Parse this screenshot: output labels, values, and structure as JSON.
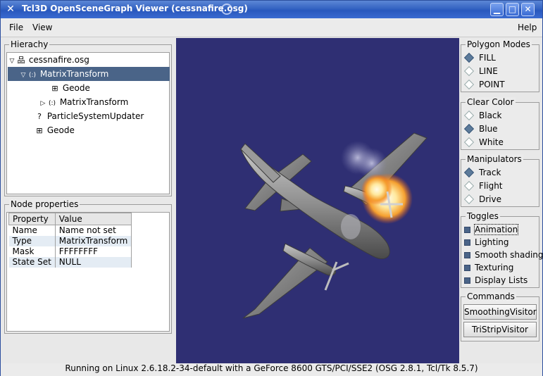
{
  "window": {
    "title": "Tcl3D OpenSceneGraph Viewer (cessnafire.osg)",
    "buttons": {
      "minimize": "▁",
      "maximize": "□",
      "close": "✕"
    }
  },
  "menubar": {
    "file": "File",
    "view": "View",
    "help": "Help"
  },
  "hierarchy": {
    "title": "Hierachy",
    "nodes": [
      {
        "label": "cessnafire.osg",
        "icon": "tree-network-icon",
        "expander": "▽"
      },
      {
        "label": "MatrixTransform",
        "icon": "transform-icon",
        "expander": "▽",
        "selected": true
      },
      {
        "label": "Geode",
        "icon": "grid-icon",
        "expander": ""
      },
      {
        "label": "MatrixTransform",
        "icon": "transform-icon",
        "expander": "▷"
      },
      {
        "label": "ParticleSystemUpdater",
        "icon": "question-icon",
        "expander": ""
      },
      {
        "label": "Geode",
        "icon": "grid-icon",
        "expander": ""
      }
    ]
  },
  "node_properties": {
    "title": "Node properties",
    "columns": [
      "Property",
      "Value"
    ],
    "rows": [
      [
        "Name",
        "Name not set"
      ],
      [
        "Type",
        "MatrixTransform"
      ],
      [
        "Mask",
        "FFFFFFFF"
      ],
      [
        "State Set",
        "NULL"
      ]
    ]
  },
  "polygon_modes": {
    "title": "Polygon Modes",
    "options": [
      "FILL",
      "LINE",
      "POINT"
    ],
    "selected": "FILL"
  },
  "clear_color": {
    "title": "Clear Color",
    "options": [
      "Black",
      "Blue",
      "White"
    ],
    "selected": "Blue"
  },
  "manipulators": {
    "title": "Manipulators",
    "options": [
      "Track",
      "Flight",
      "Drive"
    ],
    "selected": "Track"
  },
  "toggles": {
    "title": "Toggles",
    "options": [
      "Animation",
      "Lighting",
      "Smooth shading",
      "Texturing",
      "Display Lists"
    ]
  },
  "commands": {
    "title": "Commands",
    "buttons": [
      "SmoothingVisitor",
      "TriStripVisitor"
    ]
  },
  "status": "Running on Linux 2.6.18.2-34-default with a GeForce 8600 GTS/PCI/SSE2 (OSG 2.8.1, Tcl/Tk 8.5.7)",
  "colors": {
    "viewport_bg": "#2f2f73",
    "selection": "#4a6488",
    "titlebar": "#3463c2"
  }
}
